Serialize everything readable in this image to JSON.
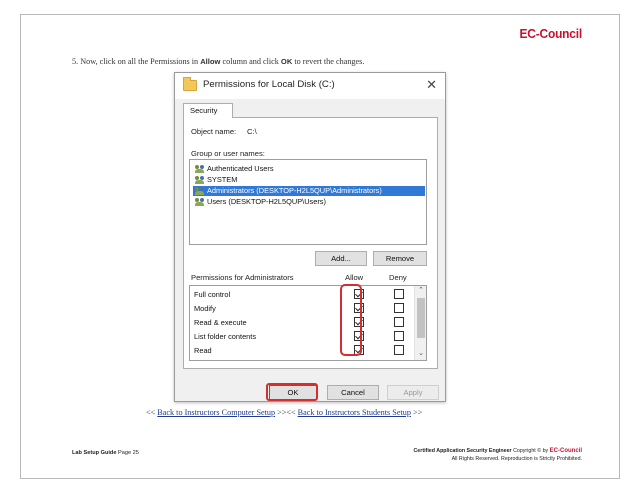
{
  "header": {
    "brand": "EC-Council"
  },
  "instruction": {
    "prefix": "5.   Now, click on all the Permissions in ",
    "allow_word": "Allow",
    "middle": " column and click ",
    "ok_word": "OK",
    "suffix": " to revert the changes."
  },
  "dialog": {
    "title": "Permissions for Local Disk (C:)",
    "close_glyph": "✕",
    "tab_label": "Security",
    "object_name_label": "Object name:",
    "object_name_value": "C:\\",
    "group_label": "Group or user names:",
    "users": [
      "Authenticated Users",
      "SYSTEM",
      "Administrators (DESKTOP-H2L5QUP\\Administrators)",
      "Users (DESKTOP-H2L5QUP\\Users)"
    ],
    "selected_user_index": 2,
    "add_button": "Add...",
    "remove_button": "Remove",
    "permissions_label": "Permissions for Administrators",
    "allow_header": "Allow",
    "deny_header": "Deny",
    "permissions": [
      {
        "name": "Full control",
        "allow": true,
        "deny": false
      },
      {
        "name": "Modify",
        "allow": true,
        "deny": false
      },
      {
        "name": "Read & execute",
        "allow": true,
        "deny": false
      },
      {
        "name": "List folder contents",
        "allow": true,
        "deny": false
      },
      {
        "name": "Read",
        "allow": true,
        "deny": false
      }
    ],
    "ok_button": "OK",
    "cancel_button": "Cancel",
    "apply_button": "Apply"
  },
  "navigation": {
    "open": "<< ",
    "link1": "Back to Instructors Computer Setup",
    "separator": " >><< ",
    "link2": "Back to Instructors Students Setup",
    "close": " >>"
  },
  "footer": {
    "left_bold": "Lab Setup Guide",
    "left_page": " Page 25",
    "right_bold": "Certified Application Security Engineer",
    "right_copyright": " Copyright © by ",
    "right_brand": "EC-Council",
    "right_rights": "All Rights Reserved. Reproduction is Strictly Prohibited."
  },
  "colors": {
    "brand": "#c8102e",
    "selection": "#3079d6",
    "highlight": "#d32f2f",
    "link": "#1f3a93"
  },
  "icons": {
    "title": "folder-icon",
    "user": "users-group-icon",
    "scroll_up": "chevron-up-icon",
    "scroll_down": "chevron-down-icon"
  }
}
